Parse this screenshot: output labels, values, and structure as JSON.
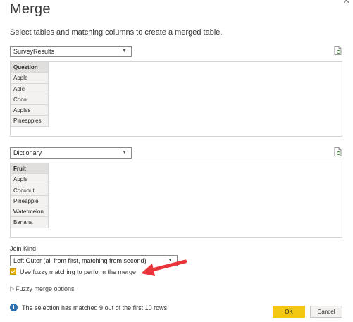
{
  "dialog": {
    "title": "Merge",
    "close_glyph": "✕",
    "subtitle": "Select tables and matching columns to create a merged table."
  },
  "table1": {
    "selected": "SurveyResults",
    "column_header": "Question",
    "rows": [
      "Apple",
      "Aple",
      "Coco",
      "Apples",
      "Pineapples"
    ]
  },
  "table2": {
    "selected": "Dictionary",
    "column_header": "Fruit",
    "rows": [
      "Apple",
      "Coconut",
      "Pineapple",
      "Watermelon",
      "Banana"
    ]
  },
  "join": {
    "label": "Join Kind",
    "selected": "Left Outer (all from first, matching from second)"
  },
  "fuzzy": {
    "checked": true,
    "label": "Use fuzzy matching to perform the merge",
    "options_toggle": "▷",
    "options_label": "Fuzzy merge options"
  },
  "status": {
    "icon": "info-icon",
    "text": "The selection has matched 9 out of the first 10 rows."
  },
  "buttons": {
    "ok": "OK",
    "cancel": "Cancel"
  },
  "colors": {
    "accent": "#F2C811",
    "arrow": "#E8343B",
    "info": "#2A6FB0"
  }
}
